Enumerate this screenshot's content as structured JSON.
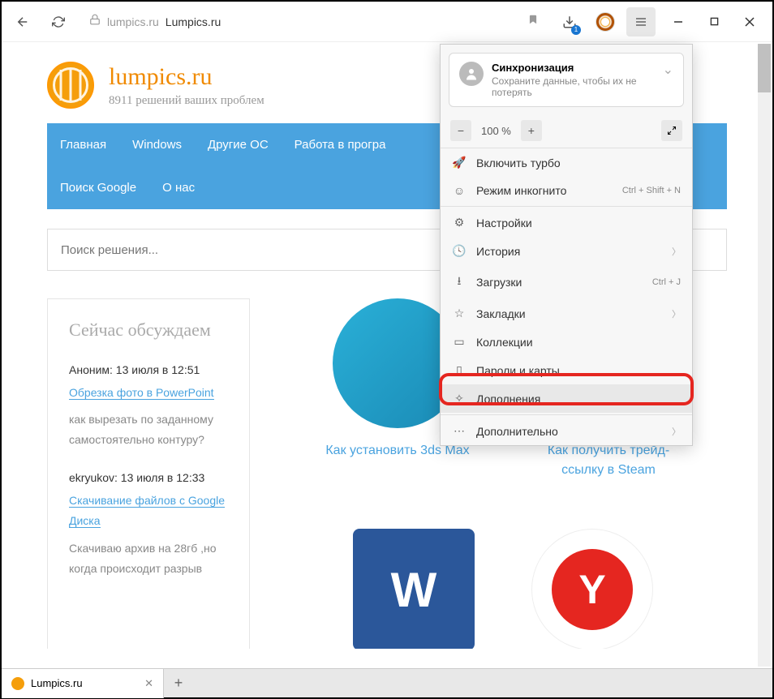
{
  "addr": {
    "domain": "lumpics.ru",
    "title": "Lumpics.ru"
  },
  "logo": {
    "title": "lumpics.ru",
    "subtitle": "8911 решений ваших проблем"
  },
  "nav": [
    "Главная",
    "Windows",
    "Другие ОС",
    "Работа в програ",
    "Поиск Google",
    "О нас"
  ],
  "search": {
    "placeholder": "Поиск решения..."
  },
  "sidebar": {
    "heading": "Сейчас обсуждаем",
    "comments": [
      {
        "meta": "Аноним: 13 июля в 12:51",
        "link": "Обрезка фото в PowerPoint",
        "body": "как вырезать по заданному самостоятельно контуру?"
      },
      {
        "meta": "ekryukov: 13 июля в 12:33",
        "link": "Скачивание файлов с Google Диска",
        "body": "Скачиваю архив на 28гб ,но когда происходит разрыв"
      }
    ]
  },
  "cards": [
    {
      "title": "Как установить 3ds Max"
    },
    {
      "title": "Как получить трейд-ссылку в Steam"
    }
  ],
  "tabs": {
    "label": "Lumpics.ru"
  },
  "menu": {
    "sync": {
      "title": "Синхронизация",
      "subtitle": "Сохраните данные, чтобы их не потерять"
    },
    "zoom": "100 %",
    "items": {
      "turbo": "Включить турбо",
      "incognito": {
        "label": "Режим инкогнито",
        "shortcut": "Ctrl + Shift + N"
      },
      "settings": "Настройки",
      "history": "История",
      "downloads": {
        "label": "Загрузки",
        "shortcut": "Ctrl + J"
      },
      "bookmarks": "Закладки",
      "collections": "Коллекции",
      "passwords": "Пароли и карты",
      "extensions": "Дополнения",
      "more": "Дополнительно"
    }
  }
}
